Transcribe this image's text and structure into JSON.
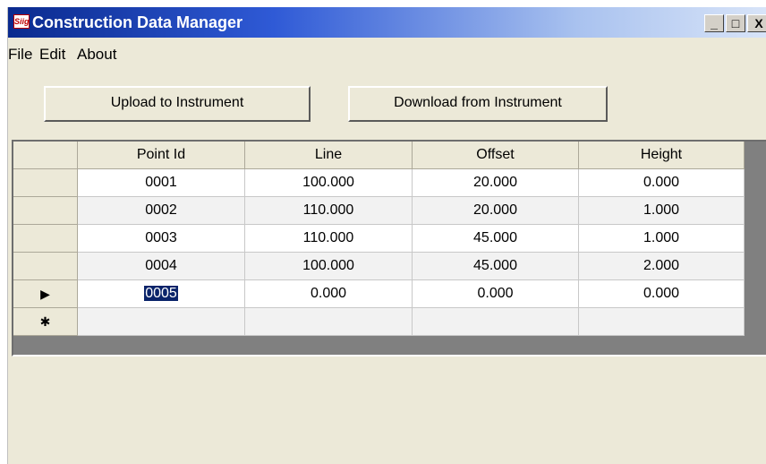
{
  "window": {
    "title": "Construction Data Manager",
    "icon_text": "Siig",
    "controls": {
      "minimize": "_",
      "maximize": "□",
      "close": "X"
    }
  },
  "menu": [
    "File",
    "Edit",
    "About"
  ],
  "toolbar": {
    "upload_label": "Upload to Instrument",
    "download_label": "Download from Instrument"
  },
  "grid": {
    "columns": [
      "Point Id",
      "Line",
      "Offset",
      "Height"
    ],
    "rows": [
      {
        "indicator": "",
        "cells": [
          "0001",
          "100.000",
          "20.000",
          "0.000"
        ]
      },
      {
        "indicator": "",
        "cells": [
          "0002",
          "110.000",
          "20.000",
          "1.000"
        ]
      },
      {
        "indicator": "",
        "cells": [
          "0003",
          "110.000",
          "45.000",
          "1.000"
        ]
      },
      {
        "indicator": "",
        "cells": [
          "0004",
          "100.000",
          "45.000",
          "2.000"
        ]
      },
      {
        "indicator": "▶",
        "cells": [
          "0005",
          "0.000",
          "0.000",
          "0.000"
        ]
      },
      {
        "indicator": "✱",
        "cells": [
          "",
          "",
          "",
          ""
        ]
      }
    ],
    "selected_cell_value": "0005"
  }
}
